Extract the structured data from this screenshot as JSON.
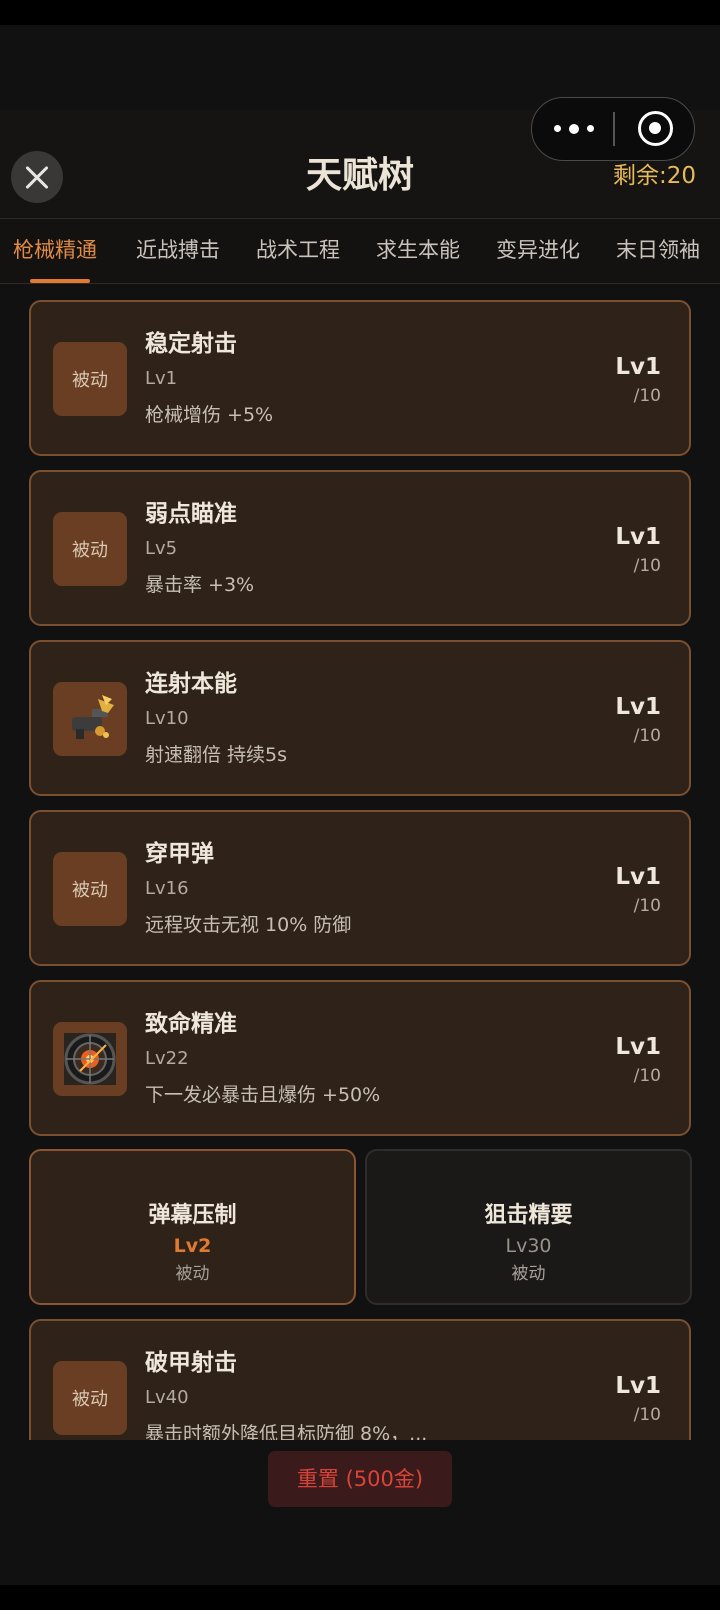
{
  "header": {
    "title": "天赋树",
    "remaining": "剩余:20"
  },
  "tabs": [
    {
      "label": "枪械精通",
      "active": true
    },
    {
      "label": "近战搏击",
      "active": false
    },
    {
      "label": "战术工程",
      "active": false
    },
    {
      "label": "求生本能",
      "active": false
    },
    {
      "label": "变异进化",
      "active": false
    },
    {
      "label": "末日领袖",
      "active": false
    }
  ],
  "talents": [
    {
      "name": "稳定射击",
      "req": "Lv1",
      "desc": "枪械增伤 +5%",
      "level": "Lv1",
      "max": "/10",
      "icon": "被动",
      "icon_name": "passive-icon"
    },
    {
      "name": "弱点瞄准",
      "req": "Lv5",
      "desc": "暴击率 +3%",
      "level": "Lv1",
      "max": "/10",
      "icon": "被动",
      "icon_name": "passive-icon"
    },
    {
      "name": "连射本能",
      "req": "Lv10",
      "desc": "射速翻倍 持续5s",
      "level": "Lv1",
      "max": "/10",
      "icon": "",
      "icon_name": "rapid-fire-gun-icon"
    },
    {
      "name": "穿甲弹",
      "req": "Lv16",
      "desc": "远程攻击无视 10% 防御",
      "level": "Lv1",
      "max": "/10",
      "icon": "被动",
      "icon_name": "passive-icon"
    },
    {
      "name": "致命精准",
      "req": "Lv22",
      "desc": "下一发必暴击且爆伤 +50%",
      "level": "Lv1",
      "max": "/10",
      "icon": "",
      "icon_name": "crosshair-target-icon"
    },
    {
      "name": "破甲射击",
      "req": "Lv40",
      "desc": "暴击时额外降低目标防御 8%，...",
      "level": "Lv1",
      "max": "/10",
      "icon": "被动",
      "icon_name": "passive-icon"
    }
  ],
  "branch_choice": [
    {
      "name": "弹幕压制",
      "level": "Lv2",
      "type": "被动",
      "selected": true
    },
    {
      "name": "狙击精要",
      "level": "Lv30",
      "type": "被动",
      "selected": false
    }
  ],
  "footer": {
    "reset_label": "重置 (500金)"
  },
  "colors": {
    "accent": "#e07a30",
    "gold": "#e7bb5a",
    "card_border": "#7a5030",
    "card_bg": "#2e2219",
    "reset_text": "#d8443a"
  }
}
